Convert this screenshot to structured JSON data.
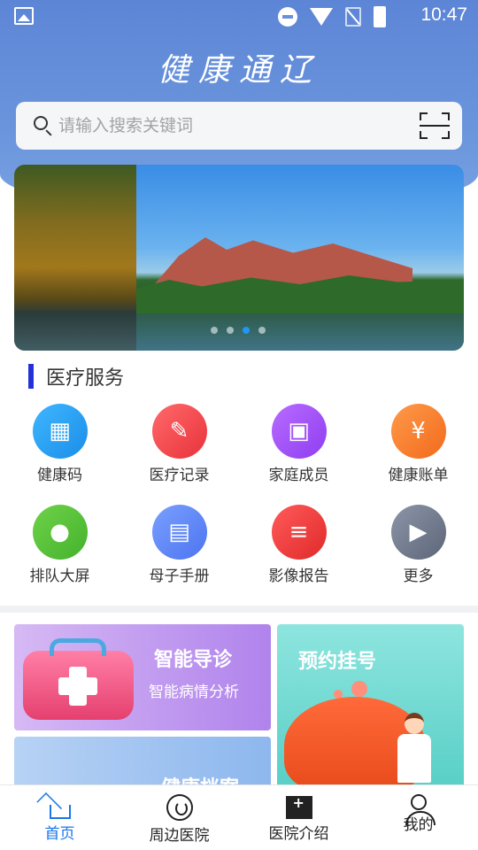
{
  "status_bar": {
    "time": "10:47"
  },
  "header": {
    "title": "健康通辽"
  },
  "search": {
    "placeholder": "请输入搜索关键词"
  },
  "banner": {
    "page_count": 4,
    "active_page": 3
  },
  "section": {
    "title": "医疗服务"
  },
  "services": [
    {
      "label": "健康码",
      "icon": "qr-code-icon",
      "color": "#2196f3"
    },
    {
      "label": "医疗记录",
      "icon": "calendar-edit-icon",
      "color": "#f03e46"
    },
    {
      "label": "家庭成员",
      "icon": "wallet-icon",
      "color": "#9b4ef2"
    },
    {
      "label": "健康账单",
      "icon": "bill-yen-icon",
      "color": "#f47a2a"
    },
    {
      "label": "排队大屏",
      "icon": "person-icon",
      "color": "#55c03a"
    },
    {
      "label": "母子手册",
      "icon": "book-icon",
      "color": "#5b80f3"
    },
    {
      "label": "影像报告",
      "icon": "report-doc-icon",
      "color": "#e83232"
    },
    {
      "label": "更多",
      "icon": "play-arrow-icon",
      "color": "#6b7487"
    }
  ],
  "cards": {
    "triage": {
      "title": "智能导诊",
      "subtitle": "智能病情分析"
    },
    "booking": {
      "title": "预约挂号"
    },
    "archive": {
      "title": "健康档案"
    }
  },
  "tabs": [
    {
      "label": "首页",
      "active": true
    },
    {
      "label": "周边医院",
      "active": false
    },
    {
      "label": "医院介绍",
      "active": false
    },
    {
      "label": "我的",
      "active": false
    }
  ]
}
